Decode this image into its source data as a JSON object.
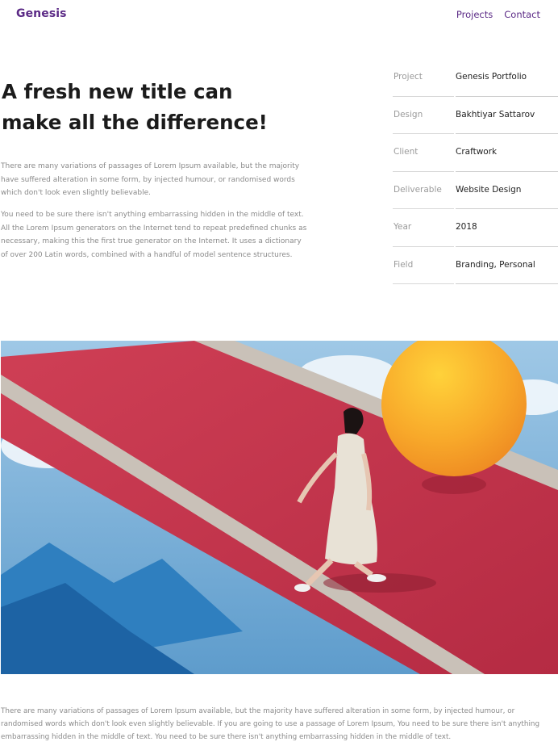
{
  "nav": {
    "brand": "Genesis",
    "links": [
      "Projects",
      "Contact"
    ]
  },
  "hero": {
    "title": "A fresh new title can make all the difference!",
    "paragraph_1": "There are many variations of passages of Lorem Ipsum available, but the majority have suffered alteration in some form, by injected humour, or randomised words which don't look even slightly believable.",
    "paragraph_2": "You need to be sure there isn't anything embarrassing hidden in the middle of text. All the Lorem Ipsum generators on the Internet tend to repeat predefined chunks as necessary, making this the first true generator on the Internet. It uses a dictionary of over 200 Latin words, combined with a handful of model sentence structures."
  },
  "meta": [
    {
      "label": "Project",
      "value": "Genesis Portfolio"
    },
    {
      "label": "Design",
      "value": "Bakhtiyar Sattarov"
    },
    {
      "label": "Client",
      "value": "Craftwork"
    },
    {
      "label": "Deliverable",
      "value": "Website Design"
    },
    {
      "label": "Year",
      "value": "2018"
    },
    {
      "label": "Field",
      "value": "Branding, Personal"
    }
  ],
  "bottom_text": "There are many variations of passages of Lorem Ipsum available, but the majority have suffered alteration in some form, by injected humour, or randomised words which don't look even slightly believable. If you are going to use a passage of Lorem Ipsum, You need to be sure there isn't anything embarrassing hidden in the middle of text. You need to be sure there isn't anything embarrassing hidden in the middle of text.",
  "colors": {
    "brand": "#5b2a86",
    "carpet": "#c8384e",
    "sky": "#7fb1d6",
    "sun": "#f4a724"
  }
}
